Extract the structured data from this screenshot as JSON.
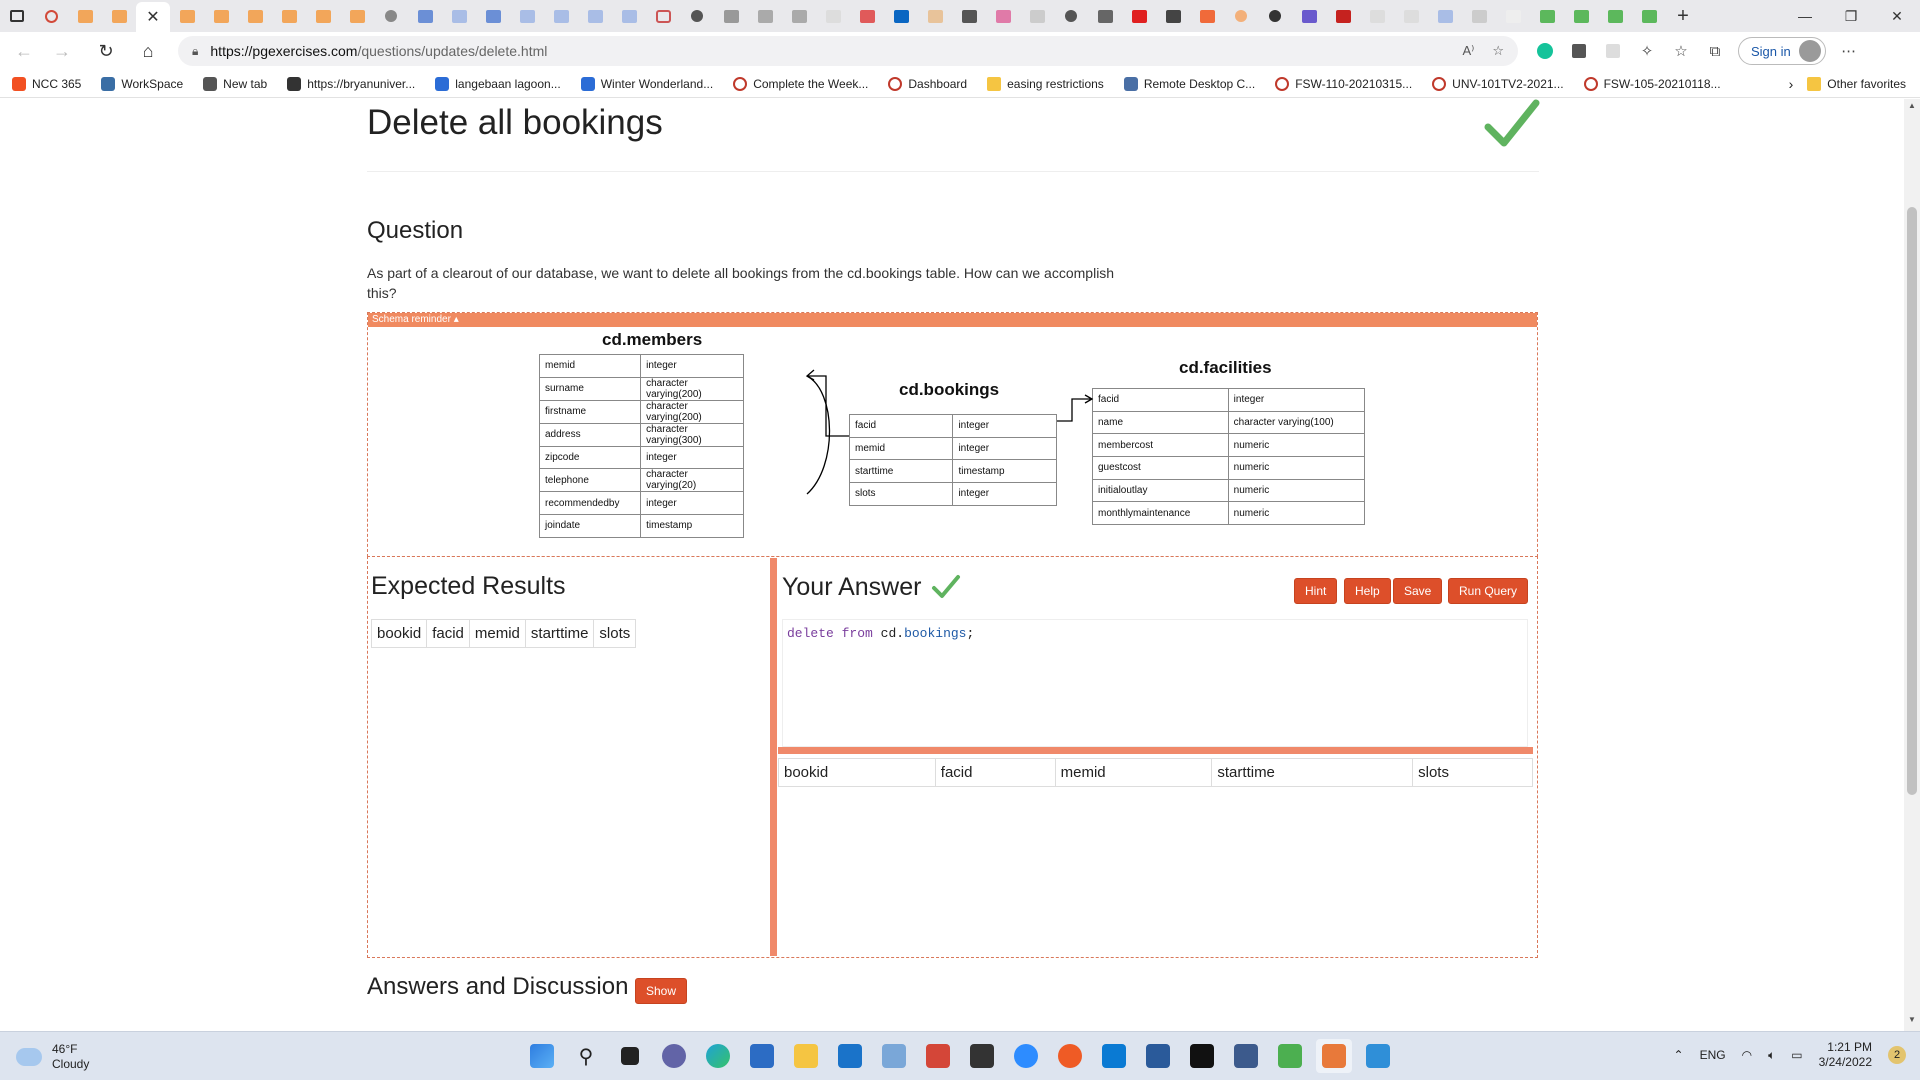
{
  "browser": {
    "url_host": "https://pgexercises.com",
    "url_path": "/questions/updates/delete.html",
    "sign_in_label": "Sign in",
    "active_tab_close": "✕"
  },
  "bookmarks": [
    {
      "label": "NCC 365",
      "icon": "microsoft-grid-icon",
      "color": "#f25022"
    },
    {
      "label": "WorkSpace",
      "icon": "workspace-icon",
      "color": "#3a6ea5"
    },
    {
      "label": "New tab",
      "icon": "new-tab-icon",
      "color": "#555555"
    },
    {
      "label": "https://bryanuniver...",
      "icon": "site-icon",
      "color": "#333333"
    },
    {
      "label": "langebaan lagoon...",
      "icon": "bing-icon",
      "color": "#2b6cd6"
    },
    {
      "label": "Winter Wonderland...",
      "icon": "bing-icon",
      "color": "#2b6cd6"
    },
    {
      "label": "Complete the Week...",
      "icon": "ring-icon",
      "color": "#c0392b"
    },
    {
      "label": "Dashboard",
      "icon": "ring-icon",
      "color": "#c0392b"
    },
    {
      "label": "easing restrictions",
      "icon": "folder-icon",
      "color": "#f5c542"
    },
    {
      "label": "Remote Desktop C...",
      "icon": "remote-desktop-icon",
      "color": "#4a6fa5"
    },
    {
      "label": "FSW-110-20210315...",
      "icon": "ring-icon",
      "color": "#c0392b"
    },
    {
      "label": "UNV-101TV2-2021...",
      "icon": "ring-icon",
      "color": "#c0392b"
    },
    {
      "label": "FSW-105-20210118...",
      "icon": "ring-icon",
      "color": "#c0392b"
    }
  ],
  "other_favorites": "Other favorites",
  "page": {
    "title": "Delete all bookings",
    "question_heading": "Question",
    "question_text": "As part of a clearout of our database, we want to delete all bookings from the cd.bookings table. How can we accomplish this?",
    "schema_reminder": "Schema reminder ▴",
    "expected_heading": "Expected Results",
    "answer_heading": "Your Answer",
    "buttons": {
      "hint": "Hint",
      "help": "Help",
      "save": "Save",
      "run": "Run Query",
      "show": "Show"
    },
    "answers_heading": "Answers and Discussion",
    "query": {
      "kw1": "delete",
      "kw2": "from",
      "schema": "cd",
      "table": "bookings",
      "end": ";"
    }
  },
  "schema": {
    "members": {
      "title": "cd.members",
      "rows": [
        [
          "memid",
          "integer"
        ],
        [
          "surname",
          "character varying(200)"
        ],
        [
          "firstname",
          "character varying(200)"
        ],
        [
          "address",
          "character varying(300)"
        ],
        [
          "zipcode",
          "integer"
        ],
        [
          "telephone",
          "character varying(20)"
        ],
        [
          "recommendedby",
          "integer"
        ],
        [
          "joindate",
          "timestamp"
        ]
      ]
    },
    "bookings": {
      "title": "cd.bookings",
      "rows": [
        [
          "facid",
          "integer"
        ],
        [
          "memid",
          "integer"
        ],
        [
          "starttime",
          "timestamp"
        ],
        [
          "slots",
          "integer"
        ]
      ]
    },
    "facilities": {
      "title": "cd.facilities",
      "rows": [
        [
          "facid",
          "integer"
        ],
        [
          "name",
          "character varying(100)"
        ],
        [
          "membercost",
          "numeric"
        ],
        [
          "guestcost",
          "numeric"
        ],
        [
          "initialoutlay",
          "numeric"
        ],
        [
          "monthlymaintenance",
          "numeric"
        ]
      ]
    }
  },
  "expected_columns": [
    "bookid",
    "facid",
    "memid",
    "starttime",
    "slots"
  ],
  "result_columns": [
    "bookid",
    "facid",
    "memid",
    "starttime",
    "slots"
  ],
  "taskbar": {
    "temperature": "46°F",
    "condition": "Cloudy",
    "language": "ENG",
    "time": "1:21 PM",
    "date": "3/24/2022",
    "notifications": "2"
  }
}
